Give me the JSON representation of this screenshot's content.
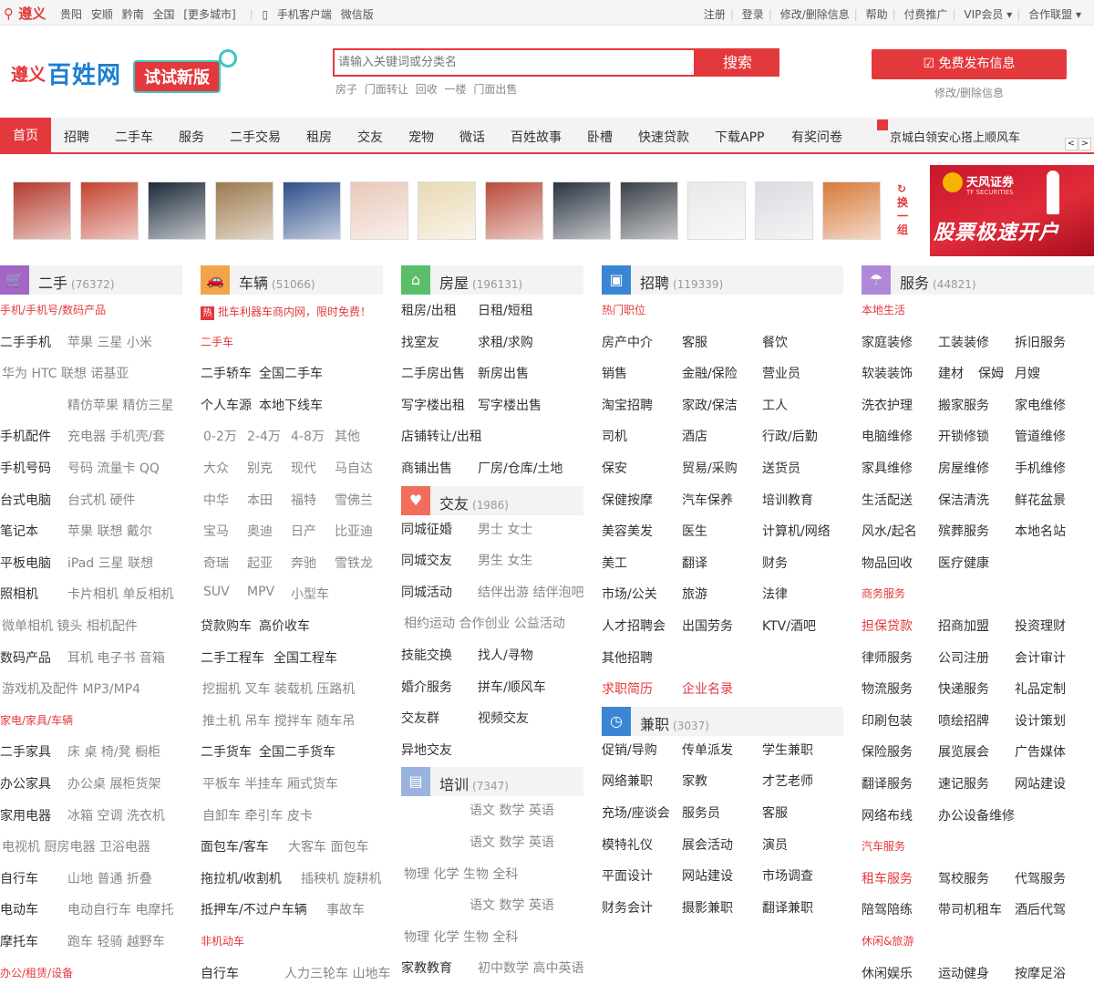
{
  "topbar": {
    "city": "遵义",
    "nearby": [
      "贵阳",
      "安顺",
      "黔南",
      "全国",
      "[更多城市]"
    ],
    "mobile": "手机客户端",
    "wechat": "微信版",
    "links": [
      "注册",
      "登录",
      "修改/删除信息",
      "帮助",
      "付费推广",
      "VIP会员",
      "合作联盟"
    ]
  },
  "logo": {
    "city": "遵义",
    "name": "百姓网",
    "try_label": "试试新版"
  },
  "search": {
    "placeholder": "请输入关键词或分类名",
    "button": "搜索",
    "hot": [
      "房子",
      "门面转让",
      "回收",
      "一楼",
      "门面出售"
    ]
  },
  "publish": {
    "button": "免费发布信息",
    "edit": "修改/删除信息"
  },
  "nav": {
    "items": [
      "首页",
      "招聘",
      "二手车",
      "服务",
      "二手交易",
      "租房",
      "交友",
      "宠物",
      "微话",
      "百姓故事",
      "卧槽",
      "快速贷款",
      "下载APP",
      "有奖问卷"
    ],
    "news": "京城白领安心搭上顺风车",
    "prev": "<",
    "next": ">"
  },
  "gallery": {
    "refresh": "换一组",
    "thumb_count": 13
  },
  "ad": {
    "brand": "天风证券",
    "brand_en": "TF SECURITIES",
    "slogan": "股票极速开户"
  },
  "colors": {
    "accent": "#e4393c",
    "link_blue": "#1b7fd1"
  },
  "cols": [
    {
      "title": "二手",
      "count": "(76372)",
      "icon": "cart-icon",
      "icon_color": "#a565c7",
      "rows": [
        {
          "t": "sub",
          "a": "手机/手机号/数码产品"
        },
        {
          "t": "row",
          "a": "二手手机",
          "b": "苹果 三星 小米"
        },
        {
          "t": "row",
          "a": "",
          "b": "华为 HTC 联想 诺基亚",
          "gray": true
        },
        {
          "t": "row",
          "a": "",
          "b": "精仿苹果 精仿三星"
        },
        {
          "t": "row",
          "a": "手机配件",
          "b": "充电器 手机壳/套"
        },
        {
          "t": "row",
          "a": "手机号码",
          "b": "号码 流量卡 QQ"
        },
        {
          "t": "row",
          "a": "台式电脑",
          "b": "台式机 硬件"
        },
        {
          "t": "row",
          "a": "笔记本",
          "b": "苹果 联想 戴尔"
        },
        {
          "t": "row",
          "a": "平板电脑",
          "b": "iPad 三星 联想"
        },
        {
          "t": "row",
          "a": "照相机",
          "b": "卡片相机 单反相机"
        },
        {
          "t": "row",
          "a": "",
          "b": "微单相机 镜头 相机配件",
          "gray": true
        },
        {
          "t": "row",
          "a": "数码产品",
          "b": "耳机 电子书 音箱"
        },
        {
          "t": "row",
          "a": "",
          "b": "游戏机及配件 MP3/MP4",
          "gray": true
        },
        {
          "t": "sub",
          "a": "家电/家具/车辆"
        },
        {
          "t": "row",
          "a": "二手家具",
          "b": "床 桌 椅/凳 橱柜"
        },
        {
          "t": "row",
          "a": "办公家具",
          "b": "办公桌 展柜货架"
        },
        {
          "t": "row",
          "a": "家用电器",
          "b": "冰箱 空调 洗衣机"
        },
        {
          "t": "row",
          "a": "",
          "b": "电视机 厨房电器 卫浴电器",
          "gray": true
        },
        {
          "t": "row",
          "a": "自行车",
          "b": "山地 普通 折叠"
        },
        {
          "t": "row",
          "a": "电动车",
          "b": "电动自行车 电摩托"
        },
        {
          "t": "row",
          "a": "摩托车",
          "b": "跑车 轻骑 越野车"
        },
        {
          "t": "sub",
          "a": "办公/租赁/设备"
        }
      ]
    },
    {
      "title": "车辆",
      "count": "(51066)",
      "icon": "car-icon",
      "icon_color": "#f0a54a",
      "promo": "批车利器车商内网，限时免费！",
      "promo_badge": "热",
      "rows": [
        {
          "t": "sub",
          "a": "二手车"
        },
        {
          "t": "row",
          "a": "二手轿车",
          "b": "全国二手车",
          "bb": true
        },
        {
          "t": "row",
          "a": "个人车源",
          "b": "本地下线车",
          "bb": true
        },
        {
          "t": "row4",
          "items": [
            "0-2万",
            "2-4万",
            "4-8万",
            "其他"
          ]
        },
        {
          "t": "row4",
          "items": [
            "大众",
            "别克",
            "现代",
            "马自达"
          ]
        },
        {
          "t": "row4",
          "items": [
            "中华",
            "本田",
            "福特",
            "雪佛兰"
          ]
        },
        {
          "t": "row4",
          "items": [
            "宝马",
            "奥迪",
            "日产",
            "比亚迪"
          ]
        },
        {
          "t": "row4",
          "items": [
            "奇瑞",
            "起亚",
            "奔驰",
            "雪铁龙"
          ]
        },
        {
          "t": "row4",
          "items": [
            "SUV",
            "MPV",
            "小型车"
          ]
        },
        {
          "t": "row",
          "a": "贷款购车",
          "b": "高价收车",
          "bb": true
        },
        {
          "t": "row",
          "a": "二手工程车",
          "b": "全国工程车",
          "bb": true
        },
        {
          "t": "row",
          "a": "",
          "b": "挖掘机 叉车 装载机 压路机",
          "gray": true
        },
        {
          "t": "row",
          "a": "",
          "b": "推土机 吊车 搅拌车 随车吊",
          "gray": true
        },
        {
          "t": "row",
          "a": "二手货车",
          "b": "全国二手货车",
          "bb": true
        },
        {
          "t": "row",
          "a": "",
          "b": "平板车 半挂车 厢式货车",
          "gray": true
        },
        {
          "t": "row",
          "a": "",
          "b": "自卸车 牵引车 皮卡",
          "gray": true
        },
        {
          "t": "row",
          "a": "面包车/客车",
          "b": "大客车 面包车"
        },
        {
          "t": "row",
          "a": "拖拉机/收割机",
          "b": "插秧机 旋耕机"
        },
        {
          "t": "row",
          "a": "抵押车/不过户车辆",
          "b": "事故车"
        },
        {
          "t": "sub",
          "a": "非机动车"
        },
        {
          "t": "row",
          "a": "自行车",
          "b": "人力三轮车 山地车"
        }
      ]
    },
    {
      "title": "房屋",
      "count": "(196131)",
      "icon": "house-icon",
      "icon_color": "#5bbf6a",
      "rows": [
        {
          "t": "pair",
          "a": "租房/出租",
          "b": "日租/短租"
        },
        {
          "t": "pair",
          "a": "找室友",
          "b": "求租/求购"
        },
        {
          "t": "pair",
          "a": "二手房出售",
          "b": "新房出售"
        },
        {
          "t": "pair",
          "a": "写字楼出租",
          "b": "写字楼出售"
        },
        {
          "t": "pair",
          "a": "店铺转让/出租",
          "b": ""
        },
        {
          "t": "pair",
          "a": "商铺出售",
          "b": "厂房/仓库/土地"
        }
      ],
      "sections": [
        {
          "title": "交友",
          "count": "(1986)",
          "icon": "heart-icon",
          "icon_color": "#f26d5b",
          "rows": [
            {
              "t": "pair",
              "a": "同城征婚",
              "b": "男士 女士",
              "bg": true
            },
            {
              "t": "pair",
              "a": "同城交友",
              "b": "男生 女生",
              "bg": true
            },
            {
              "t": "pair",
              "a": "同城活动",
              "b": "结伴出游 结伴泡吧",
              "bg": true
            },
            {
              "t": "pair",
              "a": "",
              "b": "相约运动 合作创业 公益活动",
              "full": true
            },
            {
              "t": "pair",
              "a": "技能交换",
              "b": "找人/寻物"
            },
            {
              "t": "pair",
              "a": "婚介服务",
              "b": "拼车/顺风车"
            },
            {
              "t": "pair",
              "a": "交友群",
              "b": "视频交友"
            },
            {
              "t": "pair",
              "a": "异地交友",
              "b": ""
            }
          ]
        },
        {
          "title": "培训",
          "count": "(7347)",
          "icon": "book-icon",
          "icon_color": "#9ab3dc",
          "rows": [
            {
              "t": "pair",
              "a": "",
              "b": "语文 数学 英语",
              "bg": true
            },
            {
              "t": "pair",
              "a": "",
              "b": "语文 数学 英语",
              "bg": true
            },
            {
              "t": "pair",
              "a": "",
              "b": "物理 化学 生物 全科",
              "full": true
            },
            {
              "t": "pair",
              "a": "",
              "b": "语文 数学 英语",
              "bg": true
            },
            {
              "t": "pair",
              "a": "",
              "b": "物理 化学 生物 全科",
              "full": true
            },
            {
              "t": "pair",
              "a": "家教教育",
              "b": "初中数学 高中英语",
              "bg": true
            }
          ]
        }
      ]
    },
    {
      "title": "招聘",
      "count": "(119339)",
      "icon": "briefcase-icon",
      "icon_color": "#3a86d4",
      "rows": [
        {
          "t": "sub",
          "a": "热门职位"
        },
        {
          "t": "tri",
          "items": [
            "房产中介",
            "客服",
            "餐饮"
          ]
        },
        {
          "t": "tri",
          "items": [
            "销售",
            "金融/保险",
            "营业员"
          ]
        },
        {
          "t": "tri",
          "items": [
            "淘宝招聘",
            "家政/保洁",
            "工人"
          ]
        },
        {
          "t": "tri",
          "items": [
            "司机",
            "酒店",
            "行政/后勤"
          ]
        },
        {
          "t": "tri",
          "items": [
            "保安",
            "贸易/采购",
            "送货员"
          ]
        },
        {
          "t": "tri",
          "items": [
            "保健按摩",
            "汽车保养",
            "培训教育"
          ]
        },
        {
          "t": "tri",
          "items": [
            "美容美发",
            "医生",
            "计算机/网络"
          ]
        },
        {
          "t": "tri",
          "items": [
            "美工",
            "翻译",
            "财务"
          ]
        },
        {
          "t": "tri",
          "items": [
            "市场/公关",
            "旅游",
            "法律"
          ]
        },
        {
          "t": "tri",
          "items": [
            "人才招聘会",
            "出国劳务",
            "KTV/酒吧"
          ]
        },
        {
          "t": "tri",
          "items": [
            "其他招聘"
          ]
        },
        {
          "t": "tri",
          "items": [
            "求职简历",
            "企业名录"
          ],
          "red": true
        }
      ],
      "sections": [
        {
          "title": "兼职",
          "count": "(3037)",
          "icon": "clock-icon",
          "icon_color": "#3a86d4",
          "rows": [
            {
              "t": "tri",
              "items": [
                "促销/导购",
                "传单派发",
                "学生兼职"
              ]
            },
            {
              "t": "tri",
              "items": [
                "网络兼职",
                "家教",
                "才艺老师"
              ]
            },
            {
              "t": "tri",
              "items": [
                "充场/座谈会",
                "服务员",
                "客服"
              ]
            },
            {
              "t": "tri",
              "items": [
                "模特礼仪",
                "展会活动",
                "演员"
              ]
            },
            {
              "t": "tri",
              "items": [
                "平面设计",
                "网站建设",
                "市场调查"
              ]
            },
            {
              "t": "tri",
              "items": [
                "财务会计",
                "摄影兼职",
                "翻译兼职"
              ]
            }
          ]
        }
      ]
    },
    {
      "title": "服务",
      "count": "(44821)",
      "icon": "umbrella-icon",
      "icon_color": "#b089d6",
      "rows": [
        {
          "t": "sub",
          "a": "本地生活"
        },
        {
          "t": "tri",
          "items": [
            "家庭装修",
            "工装装修",
            "拆旧服务"
          ]
        },
        {
          "t": "tri",
          "items": [
            "软装装饰",
            "建材",
            "保姆",
            "月嫂"
          ],
          "four": true
        },
        {
          "t": "tri",
          "items": [
            "洗衣护理",
            "搬家服务",
            "家电维修"
          ]
        },
        {
          "t": "tri",
          "items": [
            "电脑维修",
            "开锁修锁",
            "管道维修"
          ]
        },
        {
          "t": "tri",
          "items": [
            "家具维修",
            "房屋维修",
            "手机维修"
          ]
        },
        {
          "t": "tri",
          "items": [
            "生活配送",
            "保洁清洗",
            "鲜花盆景"
          ]
        },
        {
          "t": "tri",
          "items": [
            "风水/起名",
            "殡葬服务",
            "本地名站"
          ]
        },
        {
          "t": "tri",
          "items": [
            "物品回收",
            "医疗健康"
          ]
        },
        {
          "t": "sub",
          "a": "商务服务"
        },
        {
          "t": "tri",
          "items": [
            "担保贷款",
            "招商加盟",
            "投资理财"
          ],
          "first_red": true
        },
        {
          "t": "tri",
          "items": [
            "律师服务",
            "公司注册",
            "会计审计"
          ]
        },
        {
          "t": "tri",
          "items": [
            "物流服务",
            "快递服务",
            "礼品定制"
          ]
        },
        {
          "t": "tri",
          "items": [
            "印刷包装",
            "喷绘招牌",
            "设计策划"
          ]
        },
        {
          "t": "tri",
          "items": [
            "保险服务",
            "展览展会",
            "广告媒体"
          ]
        },
        {
          "t": "tri",
          "items": [
            "翻译服务",
            "速记服务",
            "网站建设"
          ]
        },
        {
          "t": "tri",
          "items": [
            "网络布线",
            "办公设备维修"
          ]
        },
        {
          "t": "sub",
          "a": "汽车服务"
        },
        {
          "t": "tri",
          "items": [
            "租车服务",
            "驾校服务",
            "代驾服务"
          ],
          "first_red": true
        },
        {
          "t": "tri",
          "items": [
            "陪驾陪练",
            "带司机租车",
            "酒后代驾"
          ]
        },
        {
          "t": "sub",
          "a": "休闲&旅游"
        },
        {
          "t": "tri",
          "items": [
            "休闲娱乐",
            "运动健身",
            "按摩足浴"
          ]
        }
      ]
    }
  ]
}
